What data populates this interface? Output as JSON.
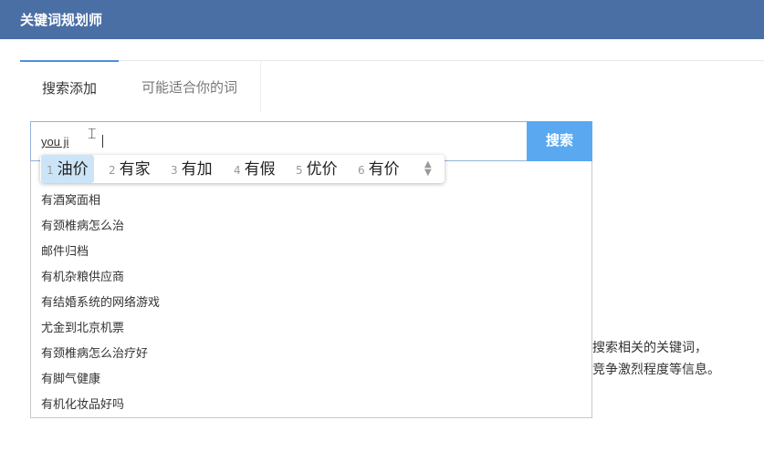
{
  "header": {
    "title": "关键词规划师"
  },
  "tabs": [
    {
      "label": "搜索添加",
      "active": true
    },
    {
      "label": "可能适合你的词",
      "active": false
    }
  ],
  "search": {
    "value": "you ji",
    "button_label": "搜索"
  },
  "ime": {
    "candidates": [
      {
        "num": "1",
        "word": "油价",
        "selected": true
      },
      {
        "num": "2",
        "word": "有家"
      },
      {
        "num": "3",
        "word": "有加"
      },
      {
        "num": "4",
        "word": "有假"
      },
      {
        "num": "5",
        "word": "优价"
      },
      {
        "num": "6",
        "word": "有价"
      }
    ],
    "more_icon": "double-chevron-down-icon"
  },
  "suggestions": [
    "有酒窝面相",
    "有颈椎病怎么治",
    "邮件归档",
    "有机杂粮供应商",
    "有结婚系统的网络游戏",
    "尤金到北京机票",
    "有颈椎病怎么治疗好",
    "有脚气健康",
    "有机化妆品好吗"
  ],
  "background_text": {
    "line1": "搜索相关的关键词，",
    "line2": "竞争激烈程度等信息。"
  },
  "colors": {
    "header_bg": "#4a6fa5",
    "button_bg": "#5aa9f0",
    "active_tab_border": "#4a90d9",
    "ime_selected": "#cce4f7"
  }
}
